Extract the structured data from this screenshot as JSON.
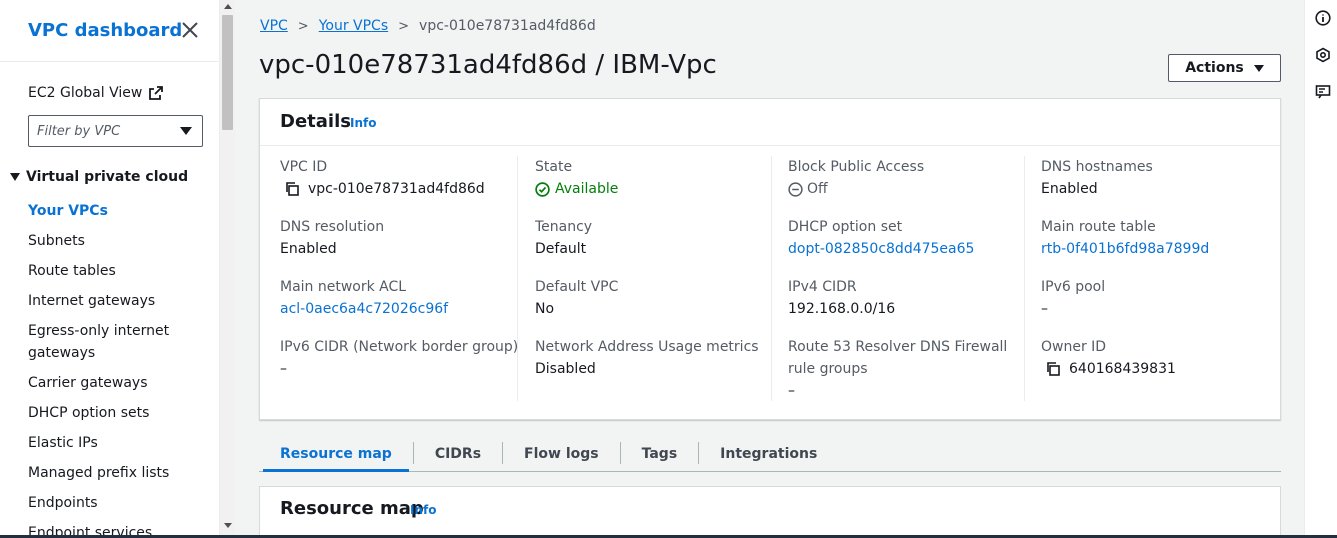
{
  "sidebar": {
    "title": "VPC dashboard",
    "ec2_global_view": "EC2 Global View",
    "filter_placeholder": "Filter by VPC",
    "section": "Virtual private cloud",
    "items": [
      {
        "label": "Your VPCs",
        "active": true
      },
      {
        "label": "Subnets"
      },
      {
        "label": "Route tables"
      },
      {
        "label": "Internet gateways"
      },
      {
        "label": "Egress-only internet gateways"
      },
      {
        "label": "Carrier gateways"
      },
      {
        "label": "DHCP option sets"
      },
      {
        "label": "Elastic IPs"
      },
      {
        "label": "Managed prefix lists"
      },
      {
        "label": "Endpoints"
      },
      {
        "label": "Endpoint services"
      }
    ]
  },
  "breadcrumb": {
    "items": [
      "VPC",
      "Your VPCs"
    ],
    "current": "vpc-010e78731ad4fd86d"
  },
  "page_title": "vpc-010e78731ad4fd86d / IBM-Vpc",
  "actions_label": "Actions",
  "details": {
    "title": "Details",
    "info": "Info",
    "fields": {
      "vpc_id": {
        "label": "VPC ID",
        "value": "vpc-010e78731ad4fd86d"
      },
      "state": {
        "label": "State",
        "value": "Available"
      },
      "block_public_access": {
        "label": "Block Public Access",
        "value": "Off"
      },
      "dns_hostnames": {
        "label": "DNS hostnames",
        "value": "Enabled"
      },
      "dns_resolution": {
        "label": "DNS resolution",
        "value": "Enabled"
      },
      "tenancy": {
        "label": "Tenancy",
        "value": "Default"
      },
      "dhcp_option_set": {
        "label": "DHCP option set",
        "value": "dopt-082850c8dd475ea65"
      },
      "main_route_table": {
        "label": "Main route table",
        "value": "rtb-0f401b6fd98a7899d"
      },
      "main_network_acl": {
        "label": "Main network ACL",
        "value": "acl-0aec6a4c72026c96f"
      },
      "default_vpc": {
        "label": "Default VPC",
        "value": "No"
      },
      "ipv4_cidr": {
        "label": "IPv4 CIDR",
        "value": "192.168.0.0/16"
      },
      "ipv6_pool": {
        "label": "IPv6 pool",
        "value": "–"
      },
      "ipv6_cidr": {
        "label": "IPv6 CIDR (Network border group)",
        "value": "–"
      },
      "network_address_usage": {
        "label": "Network Address Usage metrics",
        "value": "Disabled"
      },
      "route53_label_1": {
        "label": "Route 53 Resolver DNS Firewall"
      },
      "route53_label_2": {
        "label": "rule groups"
      },
      "route53_value": {
        "value": "–"
      },
      "owner_id": {
        "label": "Owner ID",
        "value": "640168439831"
      }
    }
  },
  "tabs": [
    "Resource map",
    "CIDRs",
    "Flow logs",
    "Tags",
    "Integrations"
  ],
  "resource_map": {
    "title": "Resource map",
    "info": "Info"
  },
  "colors": {
    "link": "#0972d3",
    "success": "#037f0c"
  }
}
